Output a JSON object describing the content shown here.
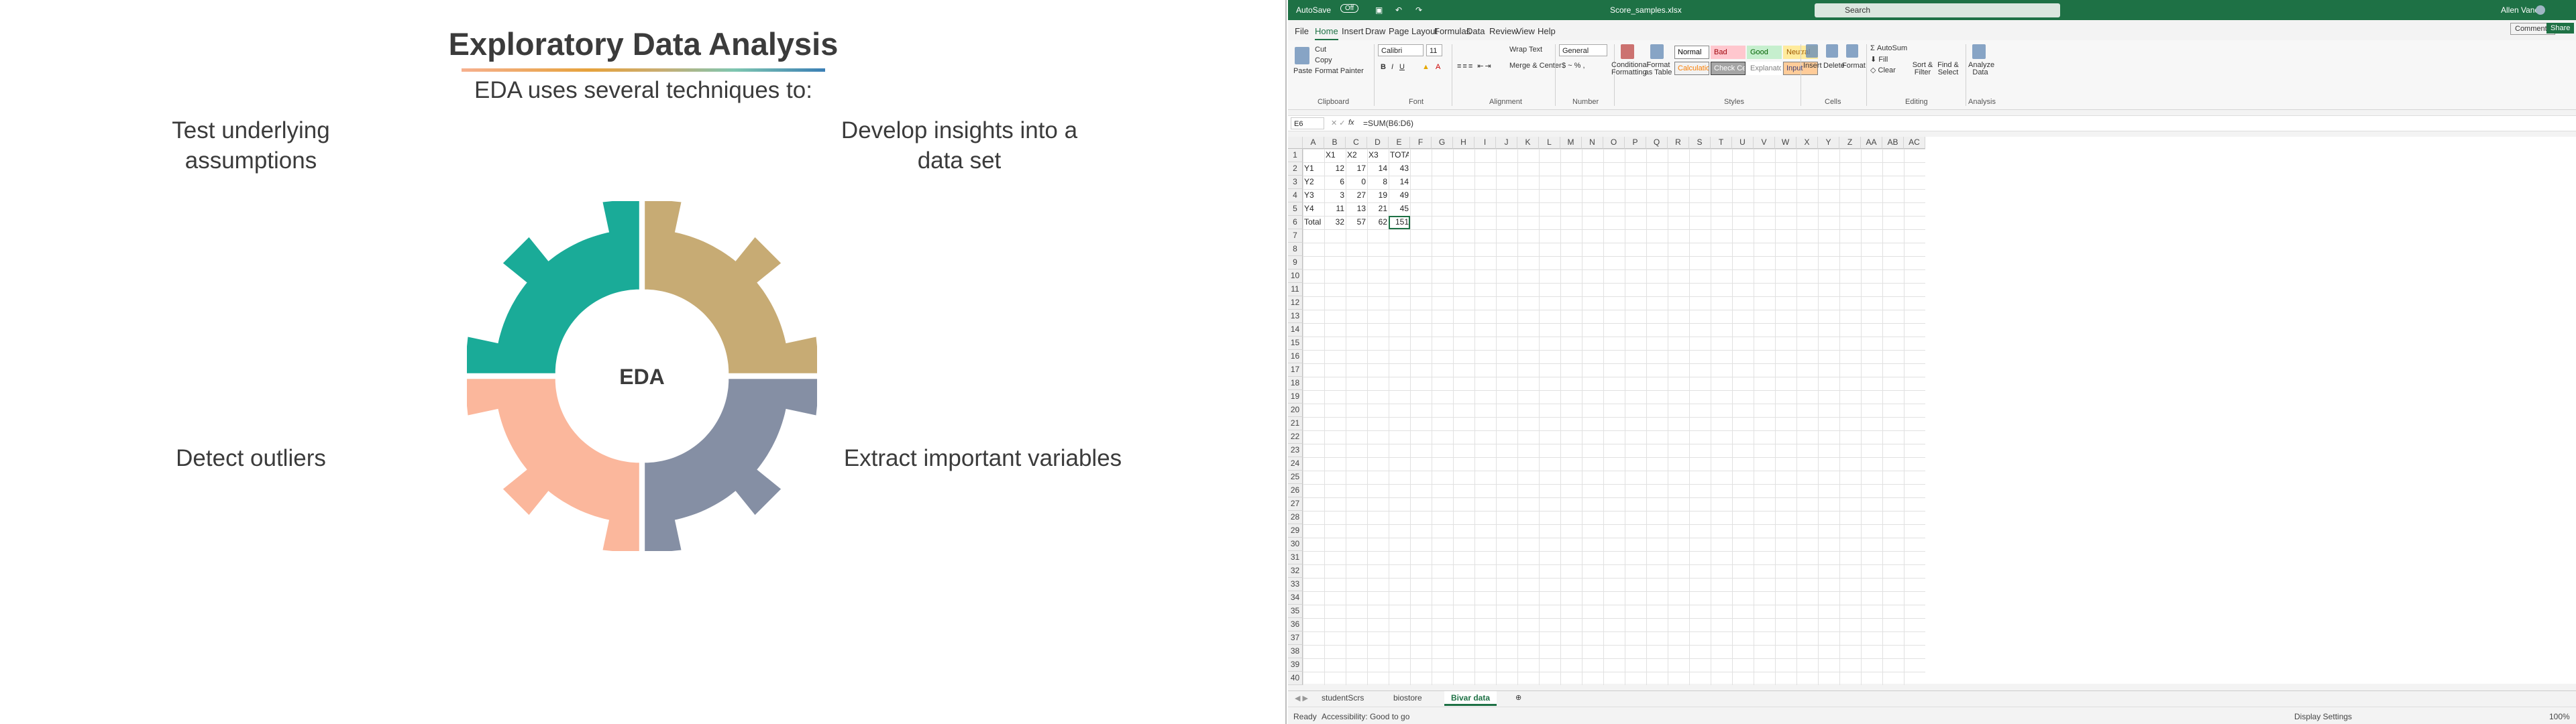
{
  "slide": {
    "title": "Exploratory Data Analysis",
    "subtitle": "EDA uses several techniques to:",
    "center_label": "EDA",
    "techniques": [
      {
        "label_line1": "Test underlying",
        "label_line2": "assumptions",
        "color": "#1aab98"
      },
      {
        "label_line1": "Develop insights into a",
        "label_line2": "data set",
        "color": "#c7ab74"
      },
      {
        "label_line1": "Detect outliers",
        "label_line2": "",
        "color": "#fbb79c"
      },
      {
        "label_line1": "Extract important variables",
        "label_line2": "",
        "color": "#858fa4"
      }
    ]
  },
  "excel": {
    "title_bar": {
      "autosave": "AutoSave",
      "autosave_state": "Off",
      "filename": "Score_samples.xlsx",
      "search": "Search",
      "user": "Allen Vanci"
    },
    "menu": [
      "File",
      "Home",
      "Insert",
      "Draw",
      "Page Layout",
      "Formulas",
      "Data",
      "Review",
      "View",
      "Help"
    ],
    "menu_active": "Home",
    "comments": "Comments",
    "share": "Share",
    "ribbon": {
      "clipboard": {
        "paste": "Paste",
        "cut": "Cut",
        "copy": "Copy",
        "format_painter": "Format Painter",
        "group": "Clipboard"
      },
      "font": {
        "name": "Calibri",
        "size": "11",
        "group": "Font"
      },
      "alignment": {
        "wrap": "Wrap Text",
        "merge": "Merge & Center",
        "group": "Alignment"
      },
      "number": {
        "format": "General",
        "group": "Number"
      },
      "styles": {
        "conditional": "Conditional Formatting",
        "format_as_table": "Format as Table",
        "group": "Styles",
        "items": [
          {
            "label": "Normal",
            "bg": "#ffffff",
            "fg": "#000000",
            "border": "#888888"
          },
          {
            "label": "Bad",
            "bg": "#ffc7ce",
            "fg": "#9c0006",
            "border": "#ffc7ce"
          },
          {
            "label": "Good",
            "bg": "#c6efce",
            "fg": "#006100",
            "border": "#c6efce"
          },
          {
            "label": "Neutral",
            "bg": "#ffeb9c",
            "fg": "#9c5700",
            "border": "#ffeb9c"
          },
          {
            "label": "Calculation",
            "bg": "#f2f2f2",
            "fg": "#fa7d00",
            "border": "#7f7f7f"
          },
          {
            "label": "Check Cell",
            "bg": "#a5a5a5",
            "fg": "#ffffff",
            "border": "#3f3f3f"
          },
          {
            "label": "Explanatory ...",
            "bg": "#ffffff",
            "fg": "#7f7f7f",
            "border": "#ffffff"
          },
          {
            "label": "Input",
            "bg": "#ffcc99",
            "fg": "#3f3f76",
            "border": "#7f7f7f"
          }
        ]
      },
      "cells": {
        "insert": "Insert",
        "delete": "Delete",
        "format": "Format",
        "group": "Cells"
      },
      "editing": {
        "autosum": "AutoSum",
        "fill": "Fill",
        "clear": "Clear",
        "sort": "Sort & Filter",
        "find": "Find & Select",
        "group": "Editing"
      },
      "analysis": {
        "analyze": "Analyze Data",
        "group": "Analysis"
      }
    },
    "formula_bar": {
      "name_box": "E6",
      "fx": "fx",
      "formula": "=SUM(B6:D6)"
    },
    "columns": [
      "A",
      "B",
      "C",
      "D",
      "E",
      "F",
      "G",
      "H",
      "I",
      "J",
      "K",
      "L",
      "M",
      "N",
      "O",
      "P",
      "Q",
      "R",
      "S",
      "T",
      "U",
      "V",
      "W",
      "X",
      "Y",
      "Z",
      "AA",
      "AB",
      "AC"
    ],
    "row_count": 40,
    "table": {
      "header": [
        "",
        "X1",
        "X2",
        "X3",
        "TOTAL"
      ],
      "rows": [
        [
          "Y1",
          "12",
          "17",
          "14",
          "43"
        ],
        [
          "Y2",
          "6",
          "0",
          "8",
          "14"
        ],
        [
          "Y3",
          "3",
          "27",
          "19",
          "49"
        ],
        [
          "Y4",
          "11",
          "13",
          "21",
          "45"
        ],
        [
          "Total",
          "32",
          "57",
          "62",
          "151"
        ]
      ]
    },
    "sheets": [
      "studentScrs",
      "biostore",
      "Bivar data"
    ],
    "active_sheet": "Bivar data",
    "status": {
      "ready": "Ready",
      "accessibility": "Accessibility: Good to go",
      "display": "Display Settings",
      "zoom": "100%"
    }
  }
}
